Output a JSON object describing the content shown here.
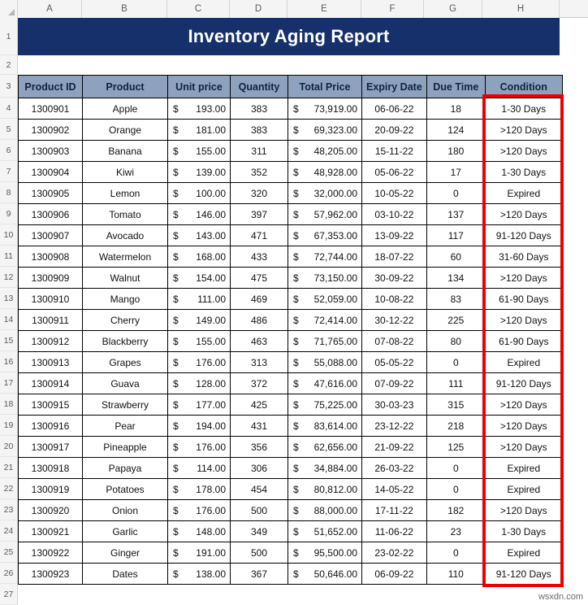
{
  "document": {
    "title": "Inventory Aging Report",
    "watermark": "wsxdn.com"
  },
  "grid": {
    "column_letters": [
      "A",
      "B",
      "C",
      "D",
      "E",
      "F",
      "G",
      "H"
    ],
    "row_numbers": [
      "1",
      "2",
      "3",
      "4",
      "5",
      "6",
      "7",
      "8",
      "9",
      "10",
      "11",
      "12",
      "13",
      "14",
      "15",
      "16",
      "17",
      "18",
      "19",
      "20",
      "21",
      "22",
      "23",
      "24",
      "25",
      "26",
      "27"
    ]
  },
  "table": {
    "headers": [
      "Product ID",
      "Product",
      "Unit price",
      "Quantity",
      "Total Price",
      "Expiry Date",
      "Due Time",
      "Condition"
    ],
    "rows": [
      {
        "product_id": "1300901",
        "product": "Apple",
        "currency": "$",
        "unit_price": "193.00",
        "quantity": "383",
        "total_currency": "$",
        "total_price": "73,919.00",
        "expiry_date": "06-06-22",
        "due_time": "18",
        "condition": "1-30 Days"
      },
      {
        "product_id": "1300902",
        "product": "Orange",
        "currency": "$",
        "unit_price": "181.00",
        "quantity": "383",
        "total_currency": "$",
        "total_price": "69,323.00",
        "expiry_date": "20-09-22",
        "due_time": "124",
        "condition": ">120 Days"
      },
      {
        "product_id": "1300903",
        "product": "Banana",
        "currency": "$",
        "unit_price": "155.00",
        "quantity": "311",
        "total_currency": "$",
        "total_price": "48,205.00",
        "expiry_date": "15-11-22",
        "due_time": "180",
        "condition": ">120 Days"
      },
      {
        "product_id": "1300904",
        "product": "Kiwi",
        "currency": "$",
        "unit_price": "139.00",
        "quantity": "352",
        "total_currency": "$",
        "total_price": "48,928.00",
        "expiry_date": "05-06-22",
        "due_time": "17",
        "condition": "1-30 Days"
      },
      {
        "product_id": "1300905",
        "product": "Lemon",
        "currency": "$",
        "unit_price": "100.00",
        "quantity": "320",
        "total_currency": "$",
        "total_price": "32,000.00",
        "expiry_date": "10-05-22",
        "due_time": "0",
        "condition": "Expired"
      },
      {
        "product_id": "1300906",
        "product": "Tomato",
        "currency": "$",
        "unit_price": "146.00",
        "quantity": "397",
        "total_currency": "$",
        "total_price": "57,962.00",
        "expiry_date": "03-10-22",
        "due_time": "137",
        "condition": ">120 Days"
      },
      {
        "product_id": "1300907",
        "product": "Avocado",
        "currency": "$",
        "unit_price": "143.00",
        "quantity": "471",
        "total_currency": "$",
        "total_price": "67,353.00",
        "expiry_date": "13-09-22",
        "due_time": "117",
        "condition": "91-120 Days"
      },
      {
        "product_id": "1300908",
        "product": "Watermelon",
        "currency": "$",
        "unit_price": "168.00",
        "quantity": "433",
        "total_currency": "$",
        "total_price": "72,744.00",
        "expiry_date": "18-07-22",
        "due_time": "60",
        "condition": "31-60 Days"
      },
      {
        "product_id": "1300909",
        "product": "Walnut",
        "currency": "$",
        "unit_price": "154.00",
        "quantity": "475",
        "total_currency": "$",
        "total_price": "73,150.00",
        "expiry_date": "30-09-22",
        "due_time": "134",
        "condition": ">120 Days"
      },
      {
        "product_id": "1300910",
        "product": "Mango",
        "currency": "$",
        "unit_price": "111.00",
        "quantity": "469",
        "total_currency": "$",
        "total_price": "52,059.00",
        "expiry_date": "10-08-22",
        "due_time": "83",
        "condition": "61-90 Days"
      },
      {
        "product_id": "1300911",
        "product": "Cherry",
        "currency": "$",
        "unit_price": "149.00",
        "quantity": "486",
        "total_currency": "$",
        "total_price": "72,414.00",
        "expiry_date": "30-12-22",
        "due_time": "225",
        "condition": ">120 Days"
      },
      {
        "product_id": "1300912",
        "product": "Blackberry",
        "currency": "$",
        "unit_price": "155.00",
        "quantity": "463",
        "total_currency": "$",
        "total_price": "71,765.00",
        "expiry_date": "07-08-22",
        "due_time": "80",
        "condition": "61-90 Days"
      },
      {
        "product_id": "1300913",
        "product": "Grapes",
        "currency": "$",
        "unit_price": "176.00",
        "quantity": "313",
        "total_currency": "$",
        "total_price": "55,088.00",
        "expiry_date": "05-05-22",
        "due_time": "0",
        "condition": "Expired"
      },
      {
        "product_id": "1300914",
        "product": "Guava",
        "currency": "$",
        "unit_price": "128.00",
        "quantity": "372",
        "total_currency": "$",
        "total_price": "47,616.00",
        "expiry_date": "07-09-22",
        "due_time": "111",
        "condition": "91-120 Days"
      },
      {
        "product_id": "1300915",
        "product": "Strawberry",
        "currency": "$",
        "unit_price": "177.00",
        "quantity": "425",
        "total_currency": "$",
        "total_price": "75,225.00",
        "expiry_date": "30-03-23",
        "due_time": "315",
        "condition": ">120 Days"
      },
      {
        "product_id": "1300916",
        "product": "Pear",
        "currency": "$",
        "unit_price": "194.00",
        "quantity": "431",
        "total_currency": "$",
        "total_price": "83,614.00",
        "expiry_date": "23-12-22",
        "due_time": "218",
        "condition": ">120 Days"
      },
      {
        "product_id": "1300917",
        "product": "Pineapple",
        "currency": "$",
        "unit_price": "176.00",
        "quantity": "356",
        "total_currency": "$",
        "total_price": "62,656.00",
        "expiry_date": "21-09-22",
        "due_time": "125",
        "condition": ">120 Days"
      },
      {
        "product_id": "1300918",
        "product": "Papaya",
        "currency": "$",
        "unit_price": "114.00",
        "quantity": "306",
        "total_currency": "$",
        "total_price": "34,884.00",
        "expiry_date": "26-03-22",
        "due_time": "0",
        "condition": "Expired"
      },
      {
        "product_id": "1300919",
        "product": "Potatoes",
        "currency": "$",
        "unit_price": "178.00",
        "quantity": "454",
        "total_currency": "$",
        "total_price": "80,812.00",
        "expiry_date": "14-05-22",
        "due_time": "0",
        "condition": "Expired"
      },
      {
        "product_id": "1300920",
        "product": "Onion",
        "currency": "$",
        "unit_price": "176.00",
        "quantity": "500",
        "total_currency": "$",
        "total_price": "88,000.00",
        "expiry_date": "17-11-22",
        "due_time": "182",
        "condition": ">120 Days"
      },
      {
        "product_id": "1300921",
        "product": "Garlic",
        "currency": "$",
        "unit_price": "148.00",
        "quantity": "349",
        "total_currency": "$",
        "total_price": "51,652.00",
        "expiry_date": "11-06-22",
        "due_time": "23",
        "condition": "1-30 Days"
      },
      {
        "product_id": "1300922",
        "product": "Ginger",
        "currency": "$",
        "unit_price": "191.00",
        "quantity": "500",
        "total_currency": "$",
        "total_price": "95,500.00",
        "expiry_date": "23-02-22",
        "due_time": "0",
        "condition": "Expired"
      },
      {
        "product_id": "1300923",
        "product": "Dates",
        "currency": "$",
        "unit_price": "138.00",
        "quantity": "367",
        "total_currency": "$",
        "total_price": "50,646.00",
        "expiry_date": "06-09-22",
        "due_time": "110",
        "condition": "91-120 Days"
      }
    ]
  },
  "colors": {
    "title_banner": "#16306b",
    "header_fill": "#8ea2bd",
    "highlight_border": "#ee0000"
  }
}
